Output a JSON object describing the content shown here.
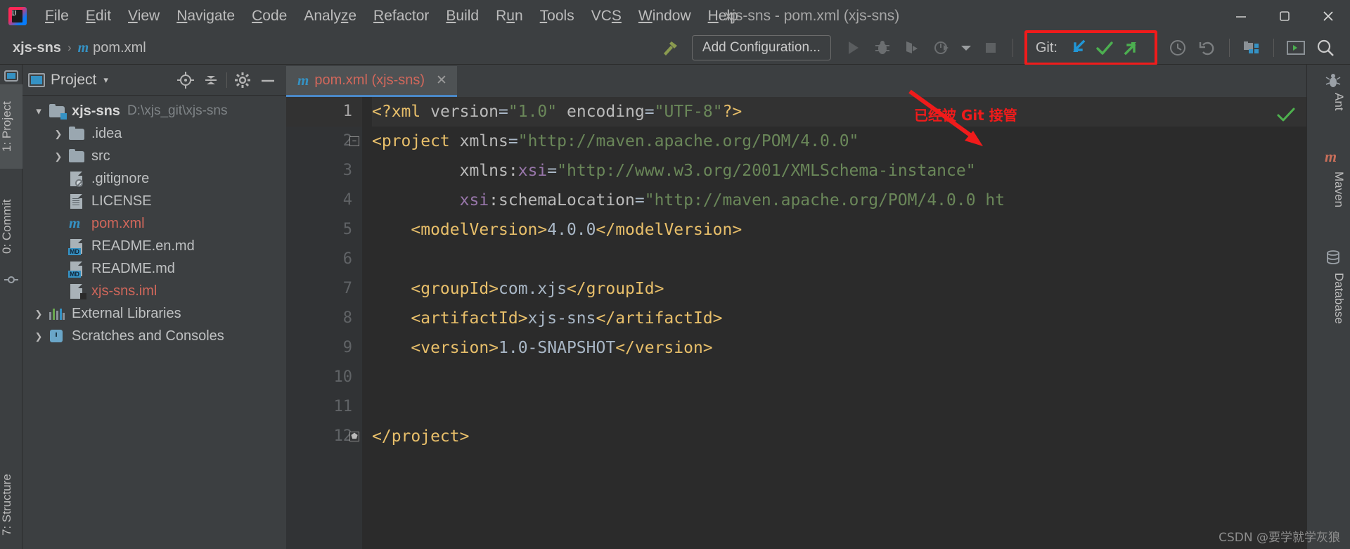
{
  "window": {
    "title": "xjs-sns - pom.xml (xjs-sns)",
    "minimize": "—",
    "maximize": "❐",
    "close": "✕",
    "logo_text": "IJ"
  },
  "menu": {
    "items": [
      {
        "label": "File",
        "mnemonic": "F"
      },
      {
        "label": "Edit",
        "mnemonic": "E"
      },
      {
        "label": "View",
        "mnemonic": "V"
      },
      {
        "label": "Navigate",
        "mnemonic": "N"
      },
      {
        "label": "Code",
        "mnemonic": "C"
      },
      {
        "label": "Analyze",
        "mnemonic": "z"
      },
      {
        "label": "Refactor",
        "mnemonic": "R"
      },
      {
        "label": "Build",
        "mnemonic": "B"
      },
      {
        "label": "Run",
        "mnemonic": "u"
      },
      {
        "label": "Tools",
        "mnemonic": "T"
      },
      {
        "label": "VCS",
        "mnemonic": "S"
      },
      {
        "label": "Window",
        "mnemonic": "W"
      },
      {
        "label": "Help",
        "mnemonic": "H"
      }
    ]
  },
  "toolbar": {
    "breadcrumb": {
      "project": "xjs-sns",
      "separator": "›",
      "file": "pom.xml",
      "file_icon": "m"
    },
    "build_icon": "hammer-icon",
    "add_configuration": "Add Configuration...",
    "run_icon": "run-icon",
    "debug_icon": "debug-icon",
    "run_coverage_icon": "run-with-coverage-icon",
    "profile_icon": "profiler-icon",
    "profile_dropdown_icon": "chevron-down-icon",
    "stop_icon": "stop-icon",
    "git_label": "Git:",
    "git_update_icon": "update-project-arrow-icon",
    "git_commit_icon": "commit-check-icon",
    "git_push_icon": "push-arrow-icon",
    "history_icon": "history-clock-icon",
    "rollback_icon": "rollback-undo-icon",
    "project_structure_icon": "project-structure-icon",
    "terminal_icon": "terminal-icon",
    "search_icon": "search-everywhere-icon"
  },
  "annotation": {
    "text": "已经被 Git 接管",
    "color": "#f01b1b",
    "highlight_color": "#f01b1b"
  },
  "left_strip": {
    "tabs": [
      {
        "label": "1: Project",
        "selected": true
      },
      {
        "label": "0: Commit",
        "selected": false
      },
      {
        "label": "7: Structure",
        "selected": false
      }
    ]
  },
  "right_strip": {
    "tabs": [
      {
        "label": "Ant",
        "icon": "ant-icon"
      },
      {
        "label": "Maven",
        "icon": "maven-icon"
      },
      {
        "label": "Database",
        "icon": "database-icon"
      }
    ]
  },
  "project_panel": {
    "title": "Project",
    "view_icon": "project-view-icon",
    "dropdown_icon": "chevron-down-icon",
    "actions": [
      {
        "name": "locate-icon",
        "glyph": "⊕"
      },
      {
        "name": "collapse-all-icon",
        "glyph": "≡"
      },
      {
        "name": "settings-gear-icon",
        "glyph": "⚙"
      },
      {
        "name": "hide-panel-icon",
        "glyph": "—"
      }
    ],
    "tree": [
      {
        "label": "xjs-sns",
        "path": "D:\\xjs_git\\xjs-sns",
        "icon": "module-folder-icon",
        "arrow": "open",
        "indent": 0,
        "bold": true,
        "color": "normal"
      },
      {
        "label": ".idea",
        "path": "",
        "icon": "folder-icon",
        "arrow": "closed",
        "indent": 1,
        "bold": false,
        "color": "normal"
      },
      {
        "label": "src",
        "path": "",
        "icon": "folder-icon",
        "arrow": "closed",
        "indent": 1,
        "bold": false,
        "color": "normal"
      },
      {
        "label": ".gitignore",
        "path": "",
        "icon": "gitignore-file-icon",
        "arrow": "none",
        "indent": 1,
        "bold": false,
        "color": "normal"
      },
      {
        "label": "LICENSE",
        "path": "",
        "icon": "text-file-icon",
        "arrow": "none",
        "indent": 1,
        "bold": false,
        "color": "normal"
      },
      {
        "label": "pom.xml",
        "path": "",
        "icon": "maven-pom-icon",
        "arrow": "none",
        "indent": 1,
        "bold": false,
        "color": "red"
      },
      {
        "label": "README.en.md",
        "path": "",
        "icon": "markdown-file-icon",
        "arrow": "none",
        "indent": 1,
        "bold": false,
        "color": "normal"
      },
      {
        "label": "README.md",
        "path": "",
        "icon": "markdown-file-icon",
        "arrow": "none",
        "indent": 1,
        "bold": false,
        "color": "normal"
      },
      {
        "label": "xjs-sns.iml",
        "path": "",
        "icon": "iml-file-icon",
        "arrow": "none",
        "indent": 1,
        "bold": false,
        "color": "red"
      },
      {
        "label": "External Libraries",
        "path": "",
        "icon": "libraries-icon",
        "arrow": "closed",
        "indent": 0,
        "bold": false,
        "color": "normal"
      },
      {
        "label": "Scratches and Consoles",
        "path": "",
        "icon": "scratches-icon",
        "arrow": "closed",
        "indent": 0,
        "bold": false,
        "color": "normal"
      }
    ]
  },
  "editor": {
    "tab": {
      "label": "pom.xml (xjs-sns)",
      "icon": "m",
      "close": "✕"
    },
    "inspection_status_icon": "inspection-ok-check",
    "line_numbers": [
      "1",
      "2",
      "3",
      "4",
      "5",
      "6",
      "7",
      "8",
      "9",
      "10",
      "11",
      "12"
    ],
    "current_line": 1,
    "fold_markers": [
      {
        "line": 2,
        "glyph": "−"
      },
      {
        "line": 12,
        "glyph": "⬟"
      }
    ],
    "lines": [
      {
        "n": 1,
        "tokens": [
          {
            "t": "<?xml ",
            "c": "tag"
          },
          {
            "t": "version",
            "c": "attr"
          },
          {
            "t": "=",
            "c": "eq"
          },
          {
            "t": "\"1.0\"",
            "c": "val"
          },
          {
            "t": " ",
            "c": "txt"
          },
          {
            "t": "encoding",
            "c": "attr"
          },
          {
            "t": "=",
            "c": "eq"
          },
          {
            "t": "\"UTF-8\"",
            "c": "val"
          },
          {
            "t": "?>",
            "c": "tag"
          }
        ]
      },
      {
        "n": 2,
        "tokens": [
          {
            "t": "<project ",
            "c": "tag"
          },
          {
            "t": "xmlns",
            "c": "attr"
          },
          {
            "t": "=",
            "c": "eq"
          },
          {
            "t": "\"http://maven.apache.org/POM/4.0.0\"",
            "c": "val"
          }
        ]
      },
      {
        "n": 3,
        "tokens": [
          {
            "t": "         ",
            "c": "txt"
          },
          {
            "t": "xmlns:",
            "c": "attr"
          },
          {
            "t": "xsi",
            "c": "ns"
          },
          {
            "t": "=",
            "c": "eq"
          },
          {
            "t": "\"http://www.w3.org/2001/XMLSchema-instance\"",
            "c": "val"
          }
        ]
      },
      {
        "n": 4,
        "tokens": [
          {
            "t": "         ",
            "c": "txt"
          },
          {
            "t": "xsi",
            "c": "ns"
          },
          {
            "t": ":schemaLocation",
            "c": "attr"
          },
          {
            "t": "=",
            "c": "eq"
          },
          {
            "t": "\"http://maven.apache.org/POM/4.0.0 ht",
            "c": "val"
          }
        ]
      },
      {
        "n": 5,
        "tokens": [
          {
            "t": "    ",
            "c": "txt"
          },
          {
            "t": "<modelVersion>",
            "c": "tag"
          },
          {
            "t": "4.0.0",
            "c": "txt"
          },
          {
            "t": "</modelVersion>",
            "c": "tag"
          }
        ]
      },
      {
        "n": 6,
        "tokens": []
      },
      {
        "n": 7,
        "tokens": [
          {
            "t": "    ",
            "c": "txt"
          },
          {
            "t": "<groupId>",
            "c": "tag"
          },
          {
            "t": "com.xjs",
            "c": "txt"
          },
          {
            "t": "</groupId>",
            "c": "tag"
          }
        ]
      },
      {
        "n": 8,
        "tokens": [
          {
            "t": "    ",
            "c": "txt"
          },
          {
            "t": "<artifactId>",
            "c": "tag"
          },
          {
            "t": "xjs-sns",
            "c": "txt"
          },
          {
            "t": "</artifactId>",
            "c": "tag"
          }
        ]
      },
      {
        "n": 9,
        "tokens": [
          {
            "t": "    ",
            "c": "txt"
          },
          {
            "t": "<version>",
            "c": "tag"
          },
          {
            "t": "1.0-SNAPSHOT",
            "c": "txt"
          },
          {
            "t": "</version>",
            "c": "tag"
          }
        ]
      },
      {
        "n": 10,
        "tokens": []
      },
      {
        "n": 11,
        "tokens": []
      },
      {
        "n": 12,
        "tokens": [
          {
            "t": "</project>",
            "c": "tag"
          }
        ]
      }
    ]
  },
  "watermark": "CSDN @要学就学灰狼",
  "colors": {
    "bg": "#3c3f41",
    "editor_bg": "#2b2b2b",
    "gutter_bg": "#313335",
    "accent_blue": "#3592c4",
    "tab_underline": "#4a88c7",
    "red_text": "#d1675b",
    "git_green": "#59a869",
    "git_blue": "#3592c4",
    "annotation_red": "#f01b1b",
    "tag": "#e8bf6a",
    "value": "#6a8759",
    "namespace": "#9876aa",
    "text": "#a9b7c6"
  }
}
